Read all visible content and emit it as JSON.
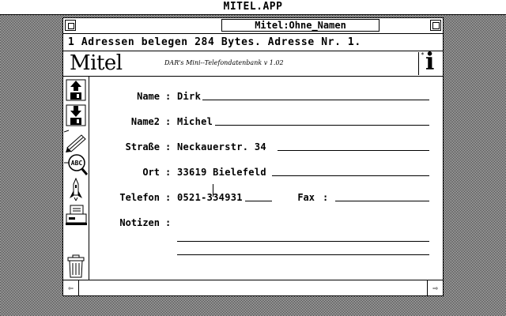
{
  "app": {
    "title": "MITEL.APP"
  },
  "window": {
    "title": "Mitel:Ohne_Namen"
  },
  "status": {
    "text": "1 Adressen belegen 284 Bytes. Adresse Nr. 1."
  },
  "header": {
    "logo": "Mitel",
    "subtitle": "DAR's Mini--Telefondatenbank v 1.02",
    "info_glyph": "i",
    "info_mark": "*"
  },
  "toolbar": {
    "tools": [
      {
        "name": "load-icon"
      },
      {
        "name": "save-icon"
      },
      {
        "name": "pencil-icon"
      },
      {
        "name": "search-abc-icon",
        "label": "ABC"
      },
      {
        "name": "rocket-icon"
      },
      {
        "name": "print-icon"
      },
      {
        "name": "trash-icon"
      }
    ]
  },
  "form": {
    "name": {
      "label": "Name",
      "value": "Dirk"
    },
    "name2": {
      "label": "Name2",
      "value": "Michel"
    },
    "strasse": {
      "label": "Straße",
      "value": "Neckauerstr. 34"
    },
    "ort": {
      "label": "Ort",
      "value": "33619 Bielefeld"
    },
    "telefon": {
      "label": "Telefon",
      "value": "0521-334931"
    },
    "fax": {
      "label": "Fax",
      "value": ""
    },
    "notizen": {
      "label": "Notizen",
      "line1": "",
      "line2": ""
    },
    "separator": ":"
  },
  "scroll": {
    "left_arrow": "⇦",
    "right_arrow": "⇨"
  }
}
